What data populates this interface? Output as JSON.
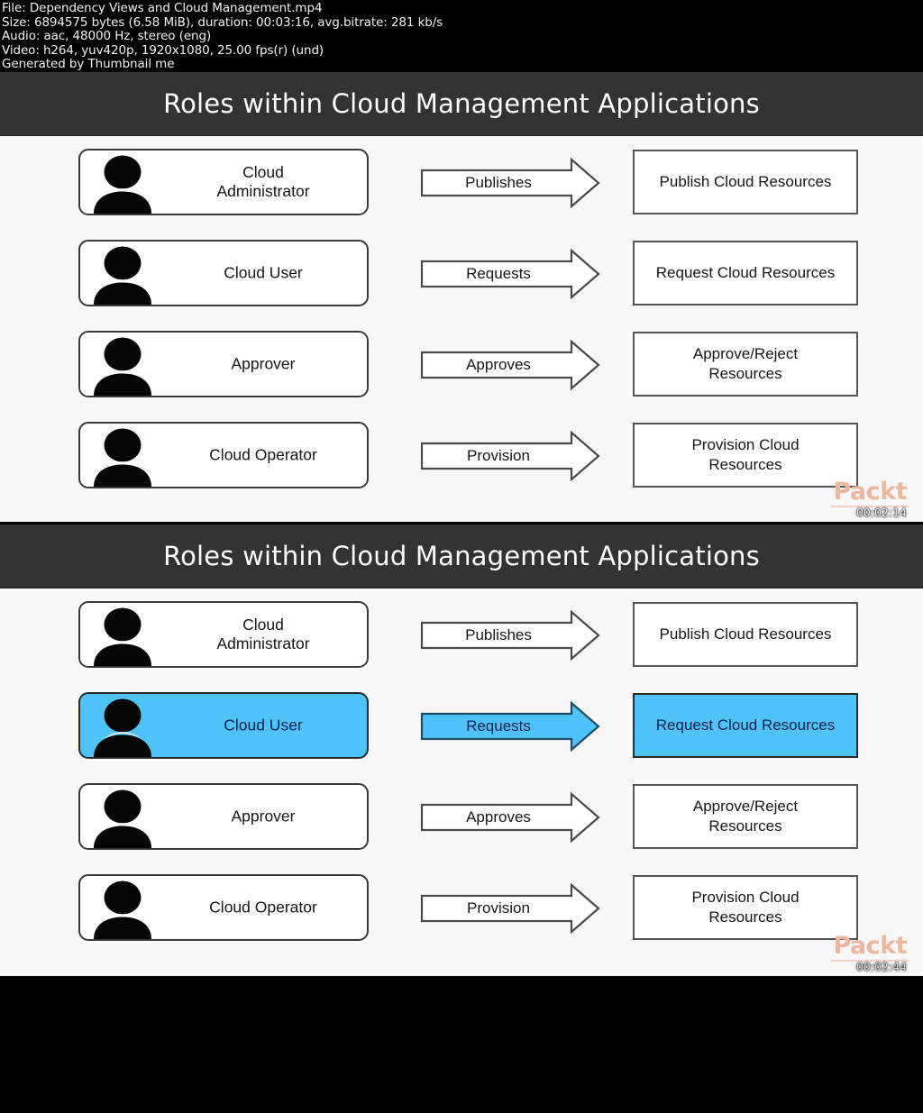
{
  "meta": {
    "lines": [
      "File: Dependency Views and Cloud Management.mp4",
      "Size: 6894575 bytes (6.58 MiB), duration: 00:03:16, avg.bitrate: 281 kb/s",
      "Audio: aac, 48000 Hz, stereo (eng)",
      "Video: h264, yuv420p, 1920x1080, 25.00 fps(r) (und)",
      "Generated by Thumbnail me"
    ]
  },
  "colors": {
    "title_bar": "#333333",
    "slide_background": "#f8f8f8",
    "highlight_blue": "#4fc3f7",
    "highlight_text": "#10204f",
    "packt_logo": "#eeb69c",
    "outline_dark": "#3a3a3a"
  },
  "slides": [
    {
      "title": "Roles within Cloud Management Applications",
      "timestamp": "00:02:14",
      "brand": "Packt",
      "rows": [
        {
          "role": "Cloud\nAdministrator",
          "action": "Publishes",
          "resource": "Publish Cloud Resources",
          "highlighted": false
        },
        {
          "role": "Cloud User",
          "action": "Requests",
          "resource": "Request Cloud Resources",
          "highlighted": false
        },
        {
          "role": "Approver",
          "action": "Approves",
          "resource": "Approve/Reject\nResources",
          "highlighted": false
        },
        {
          "role": "Cloud Operator",
          "action": "Provision",
          "resource": "Provision Cloud\nResources",
          "highlighted": false
        }
      ]
    },
    {
      "title": "Roles within Cloud Management Applications",
      "timestamp": "00:02:44",
      "brand": "Packt",
      "rows": [
        {
          "role": "Cloud\nAdministrator",
          "action": "Publishes",
          "resource": "Publish Cloud Resources",
          "highlighted": false
        },
        {
          "role": "Cloud User",
          "action": "Requests",
          "resource": "Request Cloud Resources",
          "highlighted": true
        },
        {
          "role": "Approver",
          "action": "Approves",
          "resource": "Approve/Reject\nResources",
          "highlighted": false
        },
        {
          "role": "Cloud Operator",
          "action": "Provision",
          "resource": "Provision Cloud\nResources",
          "highlighted": false
        }
      ]
    }
  ]
}
